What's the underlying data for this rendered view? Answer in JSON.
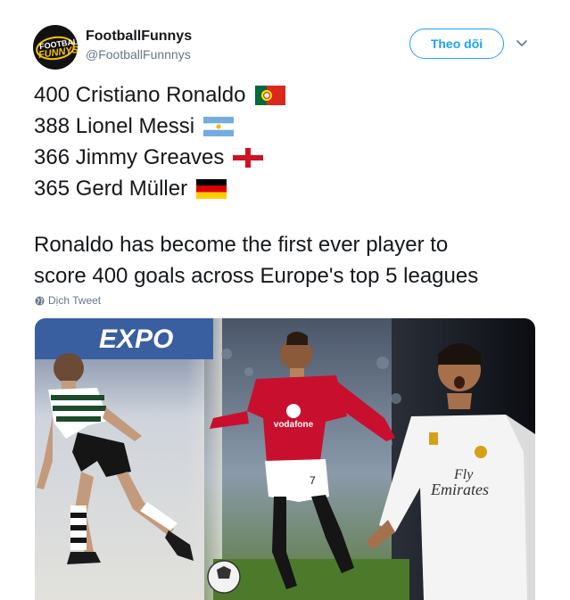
{
  "account": {
    "display_name": "FootballFunnys",
    "handle": "@FootballFunnnys",
    "avatar_text_top": "FOOTBALL",
    "avatar_text_bottom": "FUNNYS"
  },
  "header": {
    "follow_label": "Theo dõi",
    "menu_icon": "chevron-down-icon"
  },
  "tweet": {
    "rankings": [
      {
        "goals": "400",
        "name": "Cristiano Ronaldo",
        "flag": "portugal-flag"
      },
      {
        "goals": "388",
        "name": "Lionel Messi",
        "flag": "argentina-flag"
      },
      {
        "goals": "366",
        "name": "Jimmy Greaves",
        "flag": "england-flag"
      },
      {
        "goals": "365",
        "name": "Gerd Müller",
        "flag": "germany-flag"
      }
    ],
    "paragraph_lines": [
      "Ronaldo has become the first ever player to",
      "score 400 goals across Europe's top 5 leagues"
    ],
    "translate_label": "Dịch Tweet"
  },
  "media": {
    "banner_text": "EXPO",
    "kit_1_sponsor": "vodafone",
    "kit_1_number": "7",
    "kit_2_sponsor_line1": "Fly",
    "kit_2_sponsor_line2": "Emirates"
  },
  "colors": {
    "accent": "#1da1f2",
    "text": "#14171a",
    "secondary": "#657786"
  }
}
